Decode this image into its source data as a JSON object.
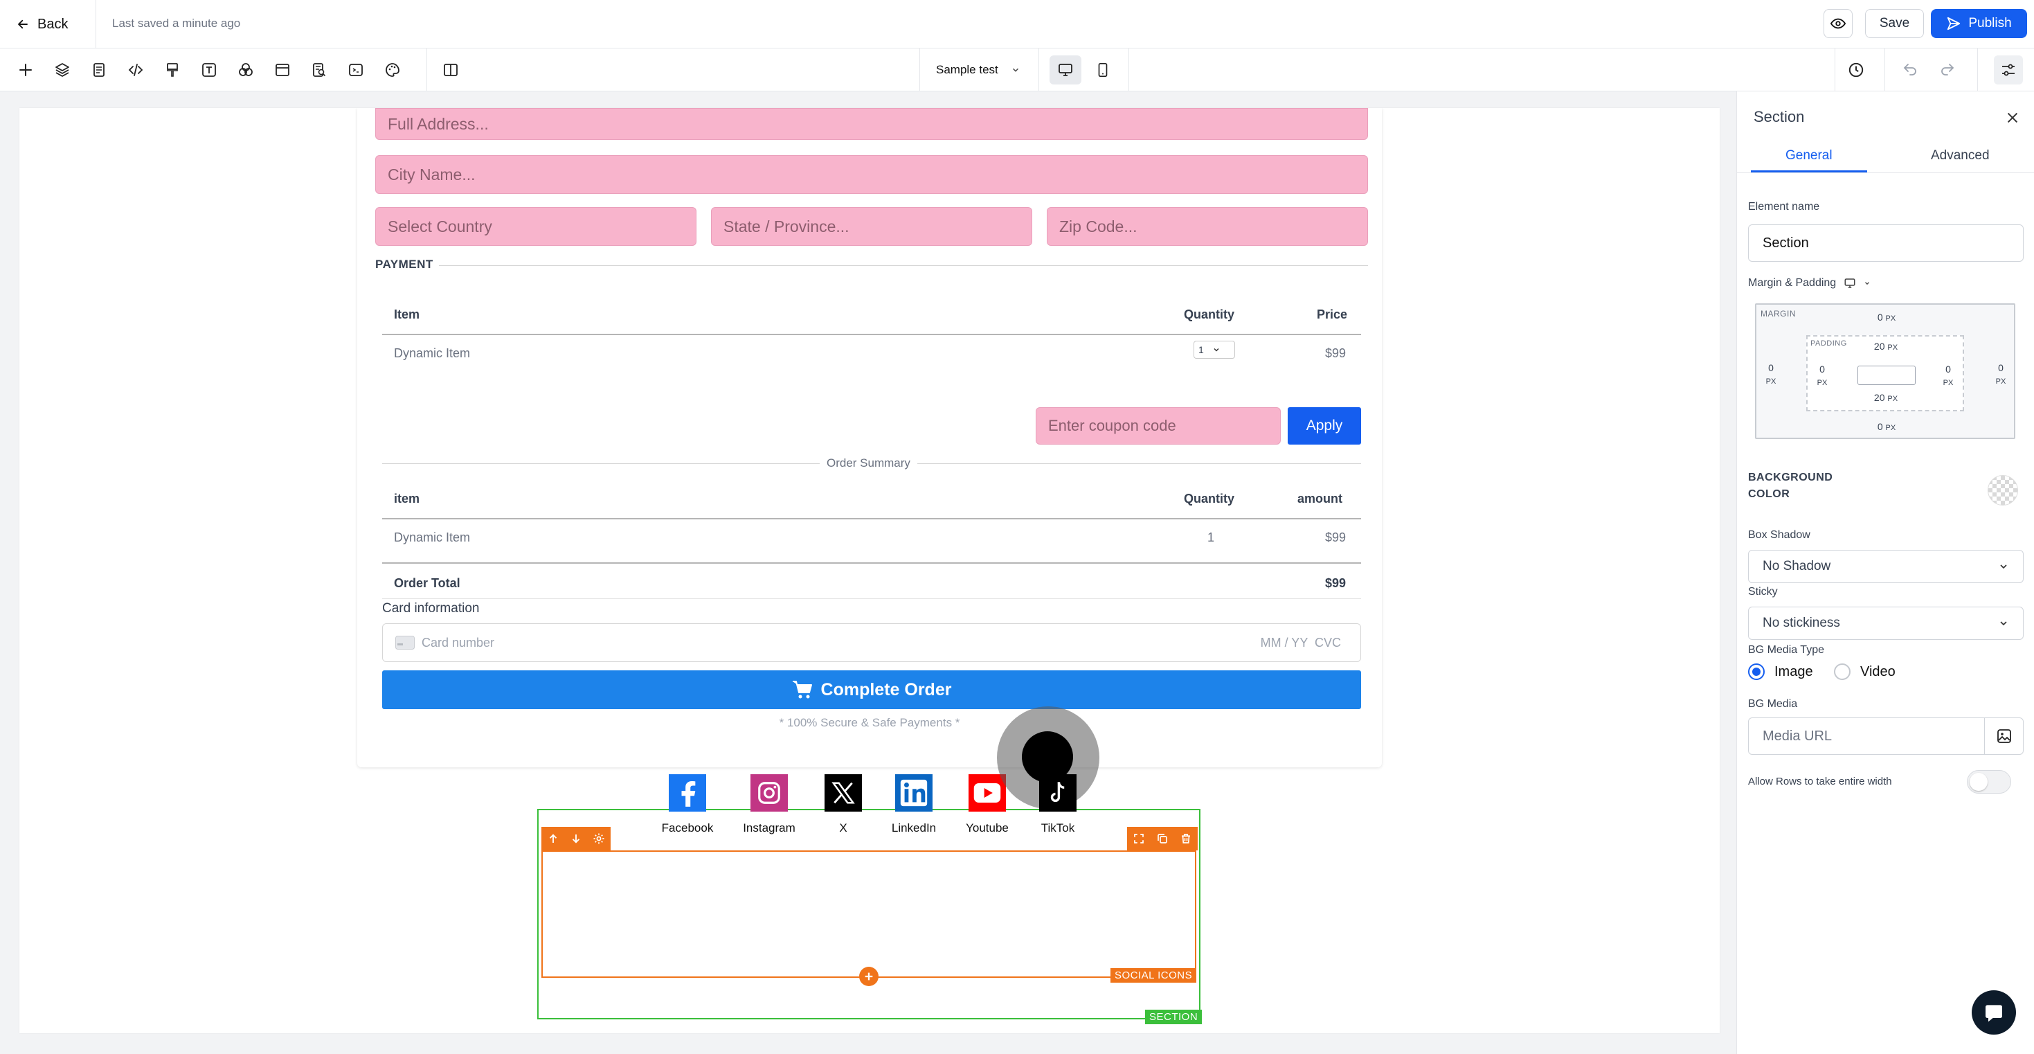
{
  "topbar": {
    "back_label": "Back",
    "saved_status": "Last saved a minute ago",
    "save_label": "Save",
    "publish_label": "Publish"
  },
  "toolbar": {
    "tools": [
      "add-icon",
      "layers-icon",
      "page-icon",
      "code-icon",
      "paint-icon",
      "text-icon",
      "shapes-icon",
      "layout-icon",
      "search-doc-icon",
      "terminal-icon",
      "palette-icon",
      "columns-icon"
    ],
    "page_selector": "Sample test"
  },
  "form": {
    "address_placeholder": "Full Address...",
    "city_placeholder": "City Name...",
    "country_placeholder": "Select Country",
    "state_placeholder": "State / Province...",
    "zip_placeholder": "Zip Code...",
    "payment_heading": "PAYMENT",
    "items_table": {
      "headers": [
        "Item",
        "Quantity",
        "Price"
      ],
      "rows": [
        {
          "item": "Dynamic Item",
          "quantity": "1",
          "price": "$99"
        }
      ]
    },
    "coupon_placeholder": "Enter coupon code",
    "apply_label": "Apply",
    "order_summary_label": "Order Summary",
    "summary_table": {
      "headers": [
        "item",
        "Quantity",
        "amount"
      ],
      "rows": [
        {
          "item": "Dynamic Item",
          "quantity": "1",
          "amount": "$99"
        }
      ],
      "total_label": "Order Total",
      "total_value": "$99"
    },
    "card_info_label": "Card information",
    "card_number_placeholder": "Card number",
    "card_exp_cvc": "MM / YY  CVC",
    "complete_label": "Complete Order",
    "secure_note": "* 100% Secure & Safe Payments *"
  },
  "social": {
    "items": [
      {
        "name": "Facebook",
        "color": "#1877f2"
      },
      {
        "name": "Instagram",
        "color": "#c13584"
      },
      {
        "name": "X",
        "color": "#000000"
      },
      {
        "name": "LinkedIn",
        "color": "#0a66c2"
      },
      {
        "name": "Youtube",
        "color": "#ff0000"
      },
      {
        "name": "TikTok",
        "color": "#000000"
      }
    ],
    "element_tag": "SOCIAL ICONS",
    "section_tag": "SECTION"
  },
  "panel": {
    "title": "Section",
    "tabs": [
      "General",
      "Advanced"
    ],
    "active_tab": "General",
    "element_name_label": "Element name",
    "element_name_value": "Section",
    "margin_padding_label": "Margin & Padding",
    "margin_label": "MARGIN",
    "padding_label": "PADDING",
    "margin": {
      "top": "0",
      "right": "0",
      "bottom": "0",
      "left": "0",
      "unit": "PX"
    },
    "padding": {
      "top": "20",
      "right": "0",
      "bottom": "20",
      "left": "0",
      "unit": "PX"
    },
    "bg_color_label": "BACKGROUND\nCOLOR",
    "box_shadow_label": "Box Shadow",
    "box_shadow_value": "No Shadow",
    "sticky_label": "Sticky",
    "sticky_value": "No stickiness",
    "bg_media_type_label": "BG Media Type",
    "media_types": [
      "Image",
      "Video"
    ],
    "media_type_selected": "Image",
    "bg_media_label": "BG Media",
    "media_url_placeholder": "Media URL",
    "allow_rows_label": "Allow Rows to take entire width",
    "allow_rows_enabled": false
  },
  "colors": {
    "accent": "#155eef",
    "field_pink": "#f8b4cc",
    "complete_blue": "#1d83ea",
    "selection_orange": "#f0741a",
    "section_green": "#3bbf3b"
  }
}
